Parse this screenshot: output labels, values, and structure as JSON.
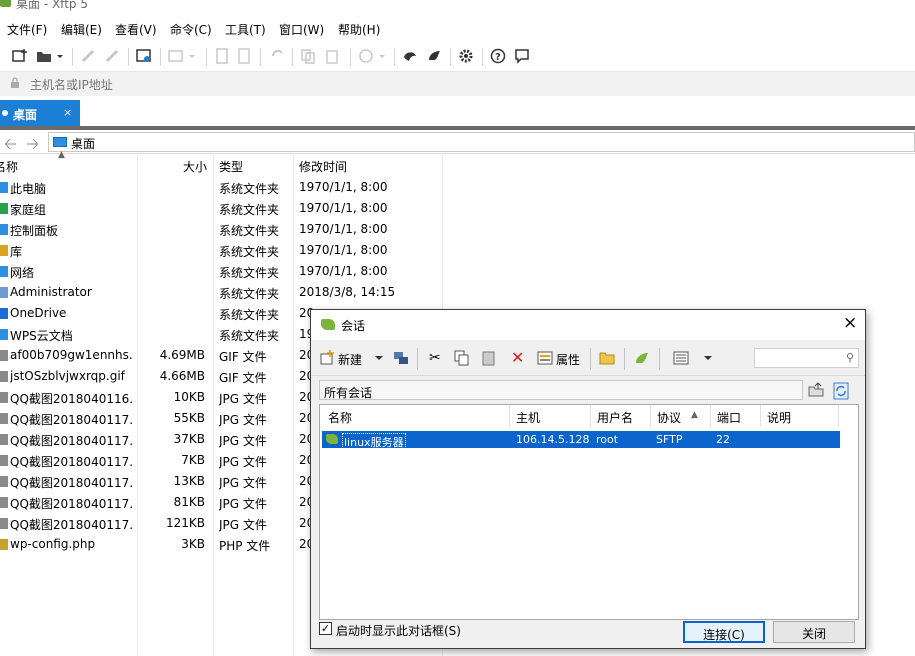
{
  "window": {
    "title": "桌面 - Xftp 5"
  },
  "menu": [
    "文件(F)",
    "编辑(E)",
    "查看(V)",
    "命令(C)",
    "工具(T)",
    "窗口(W)",
    "帮助(H)"
  ],
  "address": {
    "placeholder": "主机名或IP地址"
  },
  "tab": {
    "label": "桌面",
    "close": "×"
  },
  "path": {
    "current": "桌面"
  },
  "filelist": {
    "columns": [
      "名称",
      "大小",
      "类型",
      "修改时间"
    ],
    "rows": [
      {
        "name": "此电脑",
        "size": "",
        "type": "系统文件夹",
        "time": "1970/1/1, 8:00"
      },
      {
        "name": "家庭组",
        "size": "",
        "type": "系统文件夹",
        "time": "1970/1/1, 8:00"
      },
      {
        "name": "控制面板",
        "size": "",
        "type": "系统文件夹",
        "time": "1970/1/1, 8:00"
      },
      {
        "name": "库",
        "size": "",
        "type": "系统文件夹",
        "time": "1970/1/1, 8:00"
      },
      {
        "name": "网络",
        "size": "",
        "type": "系统文件夹",
        "time": "1970/1/1, 8:00"
      },
      {
        "name": "Administrator",
        "size": "",
        "type": "系统文件夹",
        "time": "2018/3/8, 14:15"
      },
      {
        "name": "OneDrive",
        "size": "",
        "type": "系统文件夹",
        "time": "20"
      },
      {
        "name": "WPS云文档",
        "size": "",
        "type": "系统文件夹",
        "time": "19"
      },
      {
        "name": "af00b709gw1ennhs...",
        "size": "4.69MB",
        "type": "GIF 文件",
        "time": "20"
      },
      {
        "name": "jstOSzblvjwxrqp.gif",
        "size": "4.66MB",
        "type": "GIF 文件",
        "time": "20"
      },
      {
        "name": "QQ截图2018040116...",
        "size": "10KB",
        "type": "JPG 文件",
        "time": "20"
      },
      {
        "name": "QQ截图2018040117...",
        "size": "55KB",
        "type": "JPG 文件",
        "time": "20"
      },
      {
        "name": "QQ截图2018040117...",
        "size": "37KB",
        "type": "JPG 文件",
        "time": "20"
      },
      {
        "name": "QQ截图2018040117...",
        "size": "7KB",
        "type": "JPG 文件",
        "time": "20"
      },
      {
        "name": "QQ截图2018040117...",
        "size": "13KB",
        "type": "JPG 文件",
        "time": "20"
      },
      {
        "name": "QQ截图2018040117...",
        "size": "81KB",
        "type": "JPG 文件",
        "time": "20"
      },
      {
        "name": "QQ截图2018040117...",
        "size": "121KB",
        "type": "JPG 文件",
        "time": "20"
      },
      {
        "name": "wp-config.php",
        "size": "3KB",
        "type": "PHP 文件",
        "time": "20"
      }
    ]
  },
  "dialog": {
    "title": "会话",
    "close": "×",
    "toolbar": {
      "new": "新建",
      "properties": "属性"
    },
    "path": "所有会话",
    "columns": [
      "名称",
      "主机",
      "用户名",
      "协议",
      "端口",
      "说明"
    ],
    "sessions": [
      {
        "name": "linux服务器",
        "host": "106.14.5.128",
        "user": "root",
        "protocol": "SFTP",
        "port": "22",
        "note": ""
      }
    ],
    "startup_checkbox": "启动时显示此对话框(S)",
    "startup_checked": true,
    "connect": "连接(C)",
    "close_button": "关闭"
  },
  "colors": {
    "accent": "#1c7fd6",
    "selection": "#0a64cc",
    "session_icon": "#7bb53c"
  }
}
